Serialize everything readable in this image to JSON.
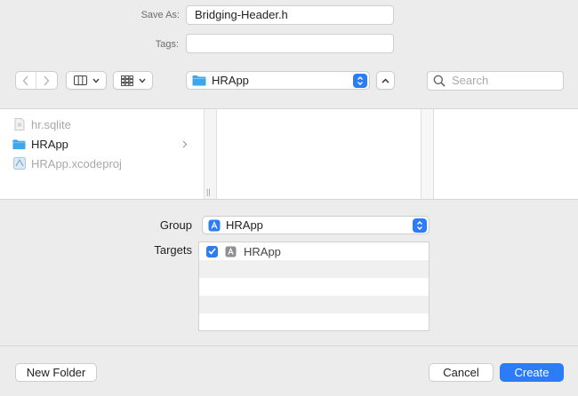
{
  "save_as": {
    "label": "Save As:",
    "value": "Bridging-Header.h"
  },
  "tags": {
    "label": "Tags:",
    "value": ""
  },
  "toolbar": {
    "location": "HRApp",
    "search_placeholder": "Search"
  },
  "browser": {
    "items": [
      {
        "name": "hr.sqlite",
        "icon": "document-icon",
        "enabled": false
      },
      {
        "name": "HRApp",
        "icon": "folder-icon",
        "enabled": true,
        "has_children": true
      },
      {
        "name": "HRApp.xcodeproj",
        "icon": "xcodeproj-icon",
        "enabled": false
      }
    ]
  },
  "group": {
    "label": "Group",
    "value": "HRApp"
  },
  "targets": {
    "label": "Targets",
    "items": [
      {
        "name": "HRApp",
        "checked": true
      }
    ]
  },
  "buttons": {
    "new_folder": "New Folder",
    "cancel": "Cancel",
    "create": "Create"
  },
  "colors": {
    "accent": "#2b7cf5",
    "folder": "#3fa7e9",
    "background": "#ececec"
  }
}
